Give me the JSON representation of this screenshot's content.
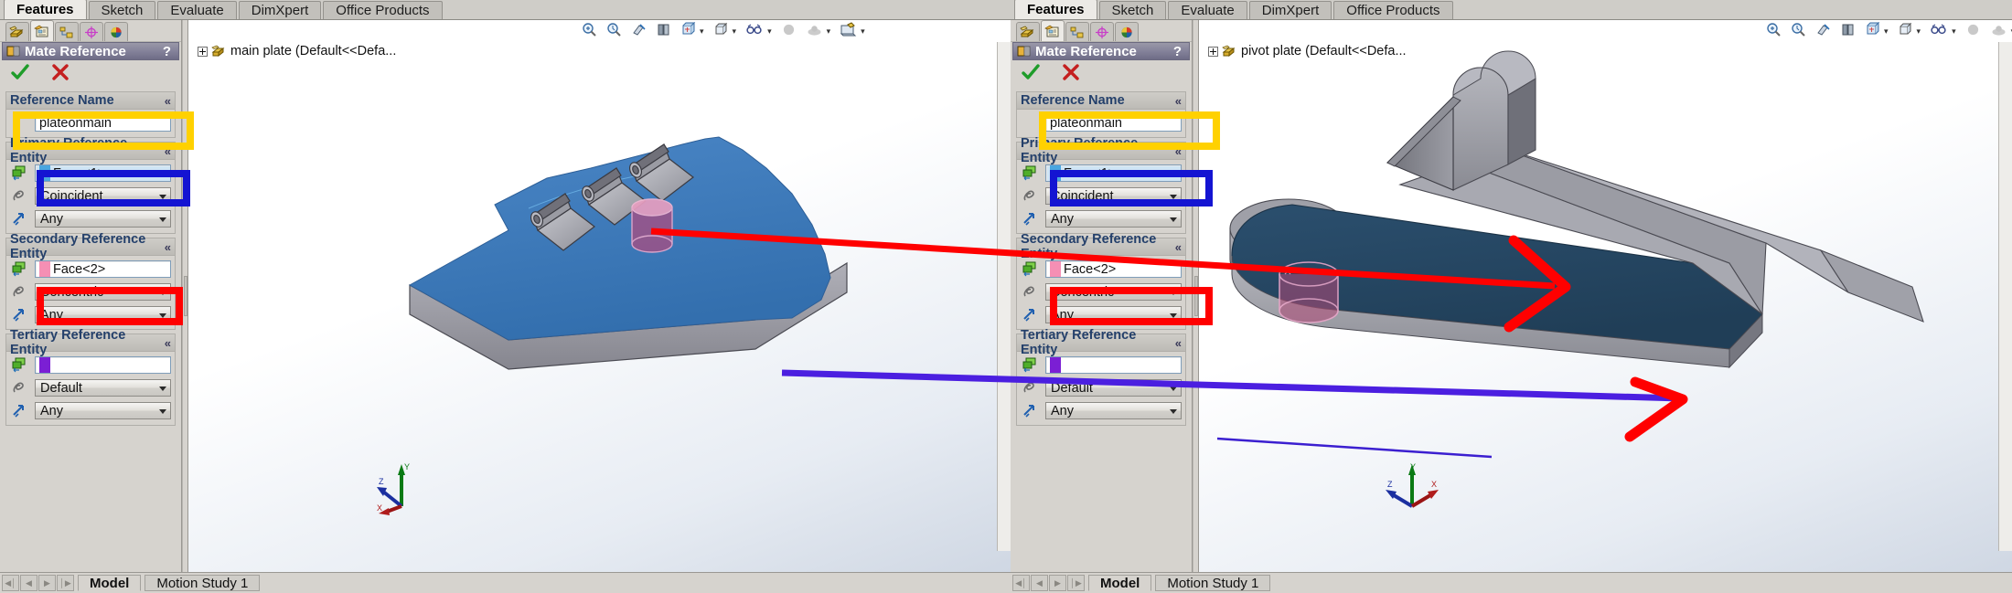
{
  "windows": [
    {
      "id": "left",
      "cmdtabs": [
        {
          "label": "Features",
          "active": true
        },
        {
          "label": "Sketch",
          "active": false
        },
        {
          "label": "Evaluate",
          "active": false
        },
        {
          "label": "DimXpert",
          "active": false
        },
        {
          "label": "Office Products",
          "active": false
        }
      ],
      "pm_tabs": [
        {
          "name": "feature-manager-tab",
          "icon": "feature-tree-icon",
          "selected": false
        },
        {
          "name": "property-manager-tab",
          "icon": "property-manager-icon",
          "selected": true
        },
        {
          "name": "configuration-manager-tab",
          "icon": "configuration-icon",
          "selected": false
        },
        {
          "name": "dimxpert-manager-tab",
          "icon": "dimxpert-icon",
          "selected": false
        },
        {
          "name": "display-manager-tab",
          "icon": "display-manager-icon",
          "selected": false
        }
      ],
      "pm_title": "Mate Reference",
      "pm_help": "?",
      "accept_label": "OK",
      "cancel_label": "Cancel",
      "groups": [
        {
          "title": "Reference Name",
          "collapse": "«",
          "rows": [
            {
              "type": "field",
              "name": "reference-name-input",
              "value": "plateonmain",
              "icon": "none",
              "swatch": null,
              "selected": false
            }
          ]
        },
        {
          "title": "Primary Reference Entity",
          "collapse": "«",
          "rows": [
            {
              "type": "field",
              "name": "primary-reference-entity-input",
              "value": "Face<1>",
              "icon": "face-select-icon",
              "swatch": "#4aa6e0",
              "selected": true
            },
            {
              "type": "combo",
              "name": "primary-mate-type-combo",
              "value": "Coincident",
              "icon": "mate-type-icon"
            },
            {
              "type": "combo",
              "name": "primary-mate-alignment-combo",
              "value": "Any",
              "icon": "alignment-icon"
            }
          ]
        },
        {
          "title": "Secondary Reference Entity",
          "collapse": "«",
          "rows": [
            {
              "type": "field",
              "name": "secondary-reference-entity-input",
              "value": "Face<2>",
              "icon": "face-select-icon",
              "swatch": "#f58fb4",
              "selected": false
            },
            {
              "type": "combo",
              "name": "secondary-mate-type-combo",
              "value": "Concentric",
              "icon": "mate-type-icon"
            },
            {
              "type": "combo",
              "name": "secondary-mate-alignment-combo",
              "value": "Any",
              "icon": "alignment-icon"
            }
          ]
        },
        {
          "title": "Tertiary Reference Entity",
          "collapse": "«",
          "rows": [
            {
              "type": "field",
              "name": "tertiary-reference-entity-input",
              "value": "",
              "icon": "face-select-icon",
              "swatch": "#7b1fd4",
              "selected": false
            },
            {
              "type": "combo",
              "name": "tertiary-mate-type-combo",
              "value": "Default",
              "icon": "mate-type-icon"
            },
            {
              "type": "combo",
              "name": "tertiary-mate-alignment-combo",
              "value": "Any",
              "icon": "alignment-icon"
            }
          ]
        }
      ],
      "tree_root": "main plate  (Default<<Defa...",
      "view_toolbar": [
        "zoom-to-fit-icon",
        "zoom-to-area-icon",
        "section-view-icon",
        "view-orientation-book-icon",
        "view-orientation-cube-icon",
        "display-style-icon",
        "hide-show-icon",
        "appearance-icon",
        "scene-icon",
        "view-settings-icon"
      ],
      "triad": {
        "x": "X",
        "y": "Y",
        "z": "Z"
      },
      "statusbar": {
        "nav": [
          "◀│",
          "◀",
          "▶",
          "│▶"
        ],
        "tabs": [
          {
            "label": "Model",
            "active": true
          },
          {
            "label": "Motion Study 1",
            "active": false
          }
        ]
      }
    },
    {
      "id": "right",
      "cmdtabs": [
        {
          "label": "Features",
          "active": true
        },
        {
          "label": "Sketch",
          "active": false
        },
        {
          "label": "Evaluate",
          "active": false
        },
        {
          "label": "DimXpert",
          "active": false
        },
        {
          "label": "Office Products",
          "active": false
        }
      ],
      "pm_tabs": [
        {
          "name": "feature-manager-tab",
          "icon": "feature-tree-icon",
          "selected": false
        },
        {
          "name": "property-manager-tab",
          "icon": "property-manager-icon",
          "selected": true
        },
        {
          "name": "configuration-manager-tab",
          "icon": "configuration-icon",
          "selected": false
        },
        {
          "name": "dimxpert-manager-tab",
          "icon": "dimxpert-icon",
          "selected": false
        },
        {
          "name": "display-manager-tab",
          "icon": "display-manager-icon",
          "selected": false
        }
      ],
      "pm_title": "Mate Reference",
      "pm_help": "?",
      "accept_label": "OK",
      "cancel_label": "Cancel",
      "groups": [
        {
          "title": "Reference Name",
          "collapse": "«",
          "rows": [
            {
              "type": "field",
              "name": "reference-name-input",
              "value": "plateonmain",
              "icon": "none",
              "swatch": null,
              "selected": false
            }
          ]
        },
        {
          "title": "Primary Reference Entity",
          "collapse": "«",
          "rows": [
            {
              "type": "field",
              "name": "primary-reference-entity-input",
              "value": "Face<1>",
              "icon": "face-select-icon",
              "swatch": "#4aa6e0",
              "selected": true
            },
            {
              "type": "combo",
              "name": "primary-mate-type-combo",
              "value": "Coincident",
              "icon": "mate-type-icon"
            },
            {
              "type": "combo",
              "name": "primary-mate-alignment-combo",
              "value": "Any",
              "icon": "alignment-icon"
            }
          ]
        },
        {
          "title": "Secondary Reference Entity",
          "collapse": "«",
          "rows": [
            {
              "type": "field",
              "name": "secondary-reference-entity-input",
              "value": "Face<2>",
              "icon": "face-select-icon",
              "swatch": "#f58fb4",
              "selected": false
            },
            {
              "type": "combo",
              "name": "secondary-mate-type-combo",
              "value": "Concentric",
              "icon": "mate-type-icon"
            },
            {
              "type": "combo",
              "name": "secondary-mate-alignment-combo",
              "value": "Any",
              "icon": "alignment-icon"
            }
          ]
        },
        {
          "title": "Tertiary Reference Entity",
          "collapse": "«",
          "rows": [
            {
              "type": "field",
              "name": "tertiary-reference-entity-input",
              "value": "",
              "icon": "face-select-icon",
              "swatch": "#7b1fd4",
              "selected": false
            },
            {
              "type": "combo",
              "name": "tertiary-mate-type-combo",
              "value": "Default",
              "icon": "mate-type-icon"
            },
            {
              "type": "combo",
              "name": "tertiary-mate-alignment-combo",
              "value": "Any",
              "icon": "alignment-icon"
            }
          ]
        }
      ],
      "tree_root": "pivot plate  (Default<<Defa...",
      "view_toolbar": [
        "zoom-to-fit-icon",
        "zoom-to-area-icon",
        "section-view-icon",
        "view-orientation-book-icon",
        "view-orientation-cube-icon",
        "display-style-icon",
        "hide-show-icon",
        "appearance-icon",
        "scene-icon",
        "view-settings-icon"
      ],
      "triad": {
        "x": "X",
        "y": "Y",
        "z": "Z"
      },
      "statusbar": {
        "nav": [
          "◀│",
          "◀",
          "▶",
          "│▶"
        ],
        "tabs": [
          {
            "label": "Model",
            "active": true
          },
          {
            "label": "Motion Study 1",
            "active": false
          }
        ]
      }
    }
  ],
  "annotations": {
    "colors": {
      "reference_name_box": "#FFD100",
      "primary_box": "#1414D2",
      "secondary_box": "#FF0000",
      "primary_arrow": "#FF0000",
      "secondary_arrow": "#4B1FE0"
    },
    "notes": [
      {
        "name": "reference-name-highlight",
        "target": "reference-name-input",
        "color": "#FFD100"
      },
      {
        "name": "primary-reference-highlight",
        "target": "primary-reference-entity-input",
        "color": "#1414D2"
      },
      {
        "name": "secondary-reference-highlight",
        "target": "secondary-reference-entity-input",
        "color": "#FF0000"
      },
      {
        "name": "primary-face-arrow",
        "color": "#FF0000",
        "from": "left-model-cylinder",
        "to": "right-model-cylinder"
      },
      {
        "name": "secondary-face-arrow",
        "color": "#4B1FE0",
        "from": "left-model-edge",
        "to": "right-model-edge"
      }
    ]
  },
  "model_colors": {
    "left_part_top": "#3d7cbe",
    "left_part_side": "#9b9ba3",
    "right_part_top": "#254560",
    "right_part_side": "#9b9ba3",
    "highlight_cylinder": "#c2567f"
  }
}
